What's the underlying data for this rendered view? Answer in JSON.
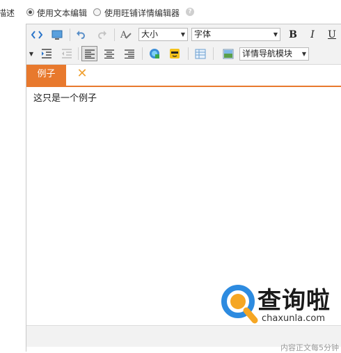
{
  "options": {
    "label": "描述",
    "radio_text": "使用文本编辑",
    "radio_wangpu": "使用旺铺详情编辑器",
    "help": "?"
  },
  "toolbar": {
    "font_size": "大小",
    "font_family": "字体",
    "bold": "B",
    "italic": "I",
    "underline": "U",
    "module_select": "详情导航模块"
  },
  "tabs": [
    {
      "label": "例子"
    }
  ],
  "editor": {
    "content": "这只是一个例子"
  },
  "footer": {
    "text": "内容正文每5分钟"
  },
  "watermark": {
    "title": "查询啦",
    "domain": "chaxunla.com"
  },
  "colors": {
    "accent": "#e8792d",
    "icon_blue": "#2a74c9"
  }
}
